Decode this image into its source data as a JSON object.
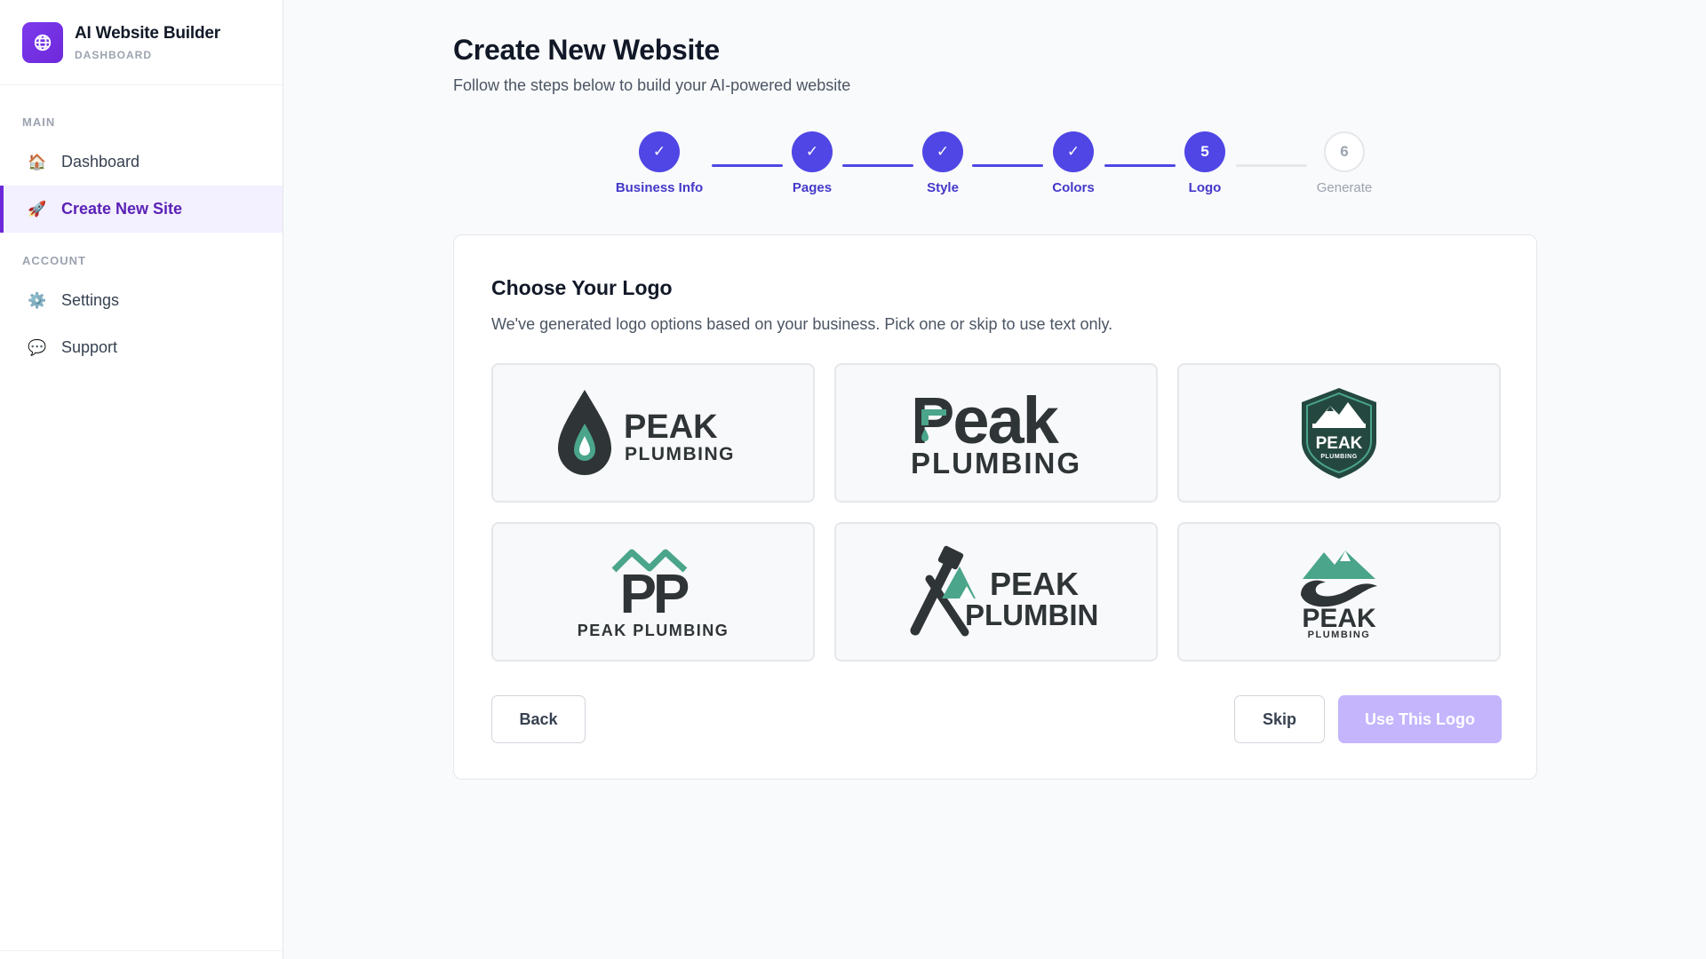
{
  "brand": {
    "title": "AI Website Builder",
    "subtitle": "DASHBOARD",
    "icon": "globe-icon"
  },
  "sidebar": {
    "sections": [
      {
        "label": "MAIN",
        "items": [
          {
            "label": "Dashboard",
            "icon": "house-icon"
          },
          {
            "label": "Create New Site",
            "icon": "rocket-icon",
            "active": true
          }
        ]
      },
      {
        "label": "ACCOUNT",
        "items": [
          {
            "label": "Settings",
            "icon": "gear-icon"
          },
          {
            "label": "Support",
            "icon": "speech-bubble-icon"
          }
        ]
      }
    ]
  },
  "page": {
    "title": "Create New Website",
    "subtitle": "Follow the steps below to build your AI-powered website"
  },
  "stepper": {
    "steps": [
      {
        "number": "1",
        "label": "Business Info",
        "state": "done"
      },
      {
        "number": "2",
        "label": "Pages",
        "state": "done"
      },
      {
        "number": "3",
        "label": "Style",
        "state": "done"
      },
      {
        "number": "4",
        "label": "Colors",
        "state": "done"
      },
      {
        "number": "5",
        "label": "Logo",
        "state": "current"
      },
      {
        "number": "6",
        "label": "Generate",
        "state": "pending"
      }
    ],
    "check_glyph": "✓"
  },
  "card": {
    "title": "Choose Your Logo",
    "description": "We've generated logo options based on your business. Pick one or skip to use text only."
  },
  "logos": [
    {
      "style": "water-drop",
      "line1": "PEAK",
      "line2": "PLUMBING"
    },
    {
      "style": "faucet-wordmark",
      "line1": "Peak",
      "line2": "PLUMBING"
    },
    {
      "style": "mountain-shield",
      "line1": "PEAK",
      "line2": "PLUMBING"
    },
    {
      "style": "pp-monogram",
      "line1": "PP",
      "line2": "PEAK PLUMBING"
    },
    {
      "style": "wrench-mountain",
      "line1": "PEAK",
      "line2": "PLUMBING"
    },
    {
      "style": "mountain-wave",
      "line1": "PEAK",
      "line2": "PLUMBING"
    }
  ],
  "colors": {
    "logo_dark": "#2f3436",
    "logo_teal": "#4aa58a",
    "logo_shield": "#24483f",
    "accent": "#4f46e5",
    "brand": "#6d28d9"
  },
  "actions": {
    "back": "Back",
    "skip": "Skip",
    "use": "Use This Logo"
  }
}
